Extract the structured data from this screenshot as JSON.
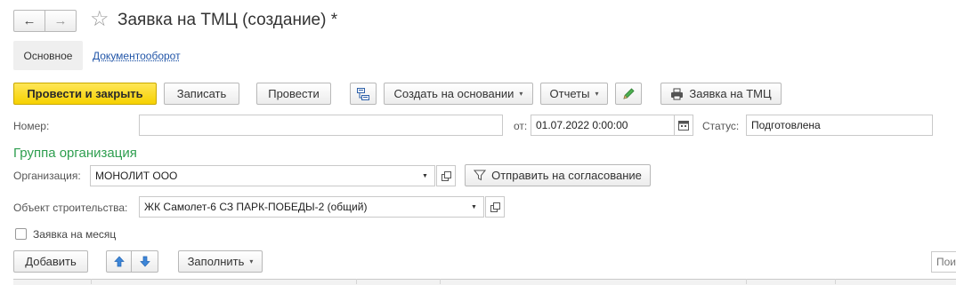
{
  "window": {
    "title": "Заявка на ТМЦ (создание) *"
  },
  "nav": {
    "back_glyph": "←",
    "forward_glyph": "→",
    "star_glyph": "☆"
  },
  "tabs": {
    "main": "Основное",
    "docflow": "Документооборот"
  },
  "toolbar": {
    "post_close": "Провести и закрыть",
    "save": "Записать",
    "post": "Провести",
    "create_based": "Создать на основании",
    "reports": "Отчеты",
    "print_request": "Заявка на ТМЦ",
    "caret": "▾"
  },
  "form": {
    "number_label": "Номер:",
    "number_value": "",
    "date_label": "от:",
    "date_value": "01.07.2022  0:00:00",
    "status_label": "Статус:",
    "status_value": "Подготовлена",
    "group_title": "Группа организация",
    "org_label": "Организация:",
    "org_value": "МОНОЛИТ ООО",
    "send_approval": "Отправить на согласование",
    "object_label": "Объект строительства:",
    "object_value": "ЖК Самолет-6  СЗ ПАРК-ПОБЕДЫ-2  (общий)",
    "monthly_label": "Заявка на месяц",
    "monthly_checked": false
  },
  "table_toolbar": {
    "add": "Добавить",
    "fill": "Заполнить",
    "search_placeholder": "Поиск"
  },
  "colors": {
    "accent_yellow": "#f6d100",
    "group_green": "#2e9e4f",
    "link_blue": "#2256a8"
  }
}
